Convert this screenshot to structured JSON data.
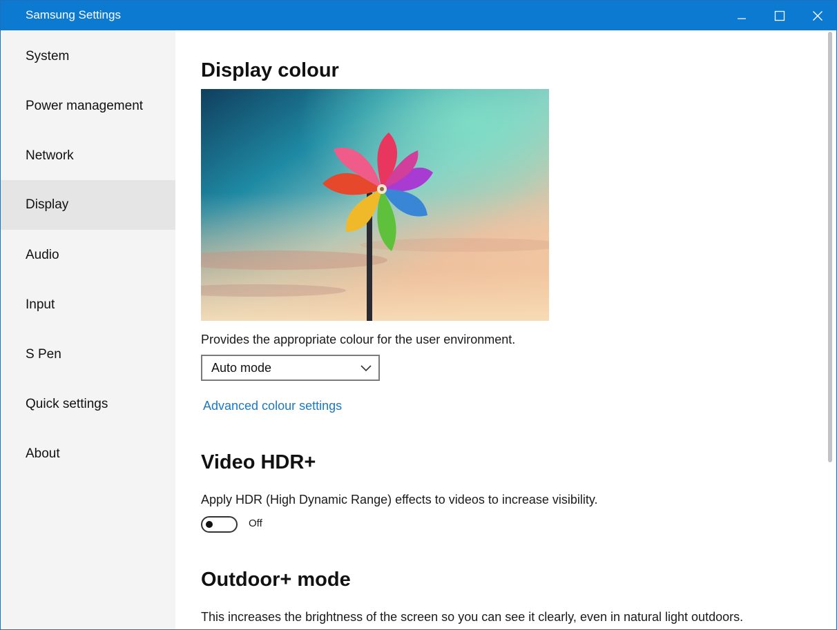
{
  "window": {
    "title": "Samsung Settings",
    "accent_color": "#0d7ad1",
    "controls": [
      "minimize-icon",
      "maximize-icon",
      "close-icon"
    ]
  },
  "sidebar": {
    "active": "Display",
    "items": [
      {
        "label": "System"
      },
      {
        "label": "Power management"
      },
      {
        "label": "Network"
      },
      {
        "label": "Display"
      },
      {
        "label": "Audio"
      },
      {
        "label": "Input"
      },
      {
        "label": "S Pen"
      },
      {
        "label": "Quick settings"
      },
      {
        "label": "About"
      }
    ]
  },
  "display_colour": {
    "title": "Display colour",
    "description": "Provides the appropriate colour for the user environment.",
    "mode_selected": "Auto mode",
    "advanced_link": "Advanced colour settings"
  },
  "video_hdr": {
    "title": "Video HDR+",
    "description": "Apply HDR (High Dynamic Range) effects to videos to increase visibility.",
    "toggle_state": "Off"
  },
  "outdoor_mode": {
    "title": "Outdoor+ mode",
    "description": "This increases the brightness of the screen so you can see it clearly, even in natural light outdoors."
  },
  "colors": {
    "link": "#1a78c2",
    "sidebar_bg": "#f4f4f4",
    "sidebar_active_bg": "#e5e5e5"
  }
}
